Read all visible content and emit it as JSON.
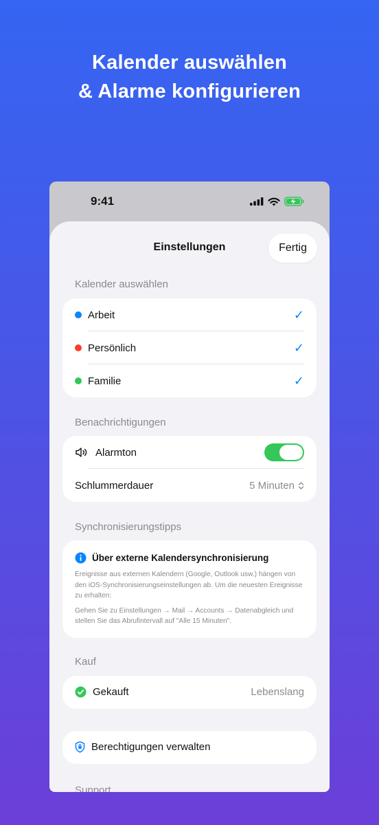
{
  "headline": {
    "line1": "Kalender auswählen",
    "line2": "& Alarme konfigurieren"
  },
  "status_bar": {
    "time": "9:41",
    "icons": [
      "signal-icon",
      "wifi-icon",
      "battery-charging-icon"
    ],
    "battery_color": "#34c759"
  },
  "nav": {
    "title": "Einstellungen",
    "done_label": "Fertig"
  },
  "calendars": {
    "header": "Kalender auswählen",
    "items": [
      {
        "label": "Arbeit",
        "color": "#0a84ff",
        "checked": true
      },
      {
        "label": "Persönlich",
        "color": "#ff3b30",
        "checked": true
      },
      {
        "label": "Familie",
        "color": "#34c759",
        "checked": true
      }
    ],
    "check_glyph": "✓"
  },
  "notifications": {
    "header": "Benachrichtigungen",
    "alarm_label": "Alarmton",
    "alarm_enabled": true,
    "snooze_label": "Schlummerdauer",
    "snooze_value": "5 Minuten"
  },
  "sync_tips": {
    "header": "Synchronisierungstipps",
    "title": "Über externe Kalendersynchronisierung",
    "paragraph1": "Ereignisse aus externen Kalendern (Google, Outlook usw.) hängen von den iOS-Synchronisierungseinstellungen ab. Um die neuesten Ereignisse zu erhalten:",
    "paragraph2": "Gehen Sie zu Einstellungen → Mail → Accounts → Datenabgleich und stellen Sie das Abrufintervall auf \"Alle 15 Minuten\"."
  },
  "purchase": {
    "header": "Kauf",
    "label": "Gekauft",
    "value": "Lebenslang"
  },
  "permissions": {
    "label": "Berechtigungen verwalten"
  },
  "support": {
    "header": "Support"
  },
  "colors": {
    "accent": "#0a84ff",
    "toggle_on": "#34c759",
    "secondary_text": "#8a8a8e"
  }
}
